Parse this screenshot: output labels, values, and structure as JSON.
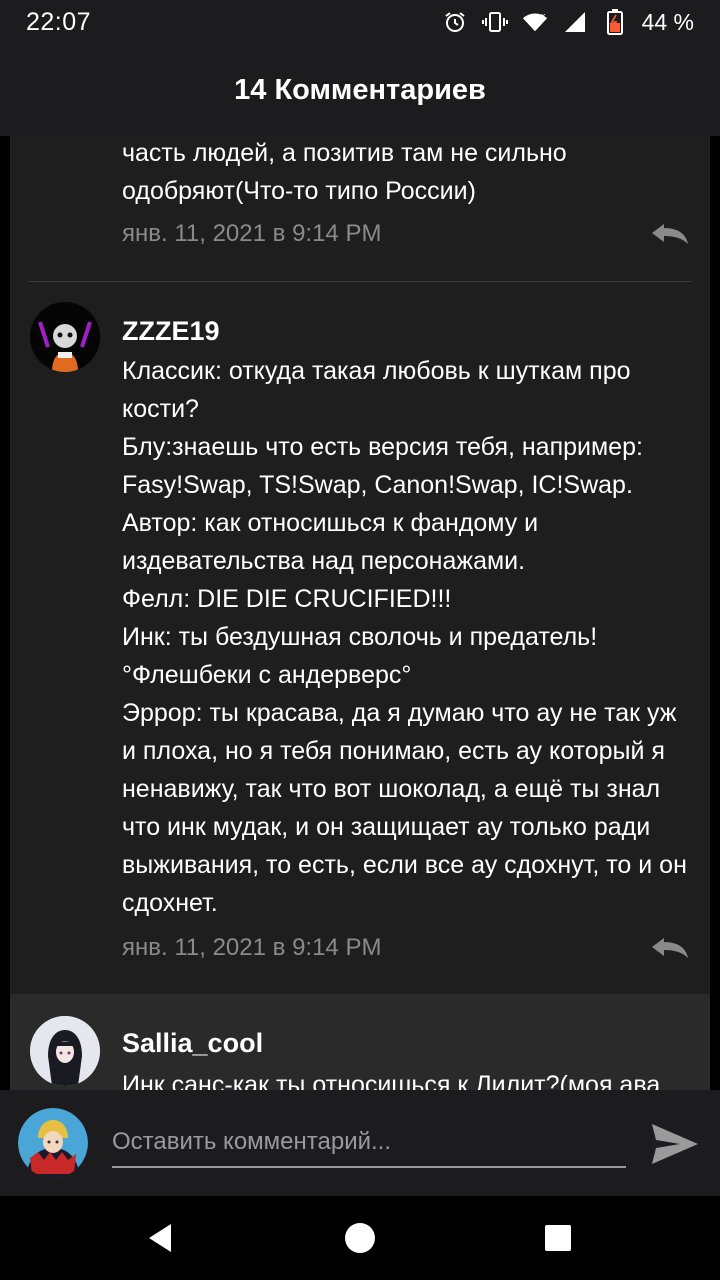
{
  "status_bar": {
    "time": "22:07",
    "battery_percent": "44 %",
    "icons": [
      "alarm-icon",
      "vibrate-icon",
      "wifi-icon",
      "signal-icon",
      "battery-icon"
    ]
  },
  "header": {
    "title": "14 Комментариев"
  },
  "comments": [
    {
      "username": "",
      "text": "часть людей, а позитив там не сильно\nодобряют(Что-то типо России)",
      "date": "янв. 11, 2021 в 9:14 PM"
    },
    {
      "username": "ZZZE19",
      "text": "Классик: откуда такая любовь к шуткам про\nкости?\nБлу:знаешь что есть версия тебя, например:\nFasy!Swap, TS!Swap, Canon!Swap, IC!Swap.\nАвтор: как относишься к фандому и\nиздевательства над персонажами.\nФелл: DIE DIE CRUCIFIED!!!\nИнк: ты бездушная сволочь и предатель!\n°Флешбеки с андерверс°\nЭррор: ты красава, да я думаю что ау не так уж\nи плоха, но я тебя понимаю, есть ау который я\nненавижу, так что вот шоколад, а ещё ты знал\nчто инк мудак, и он защищает ау только ради\nвыживания, то есть, если все ау сдохнут, то и он\nсдохнет.",
      "date": "янв. 11, 2021 в 9:14 PM"
    },
    {
      "username": "Sallia_cool",
      "text": "Инк санс-как ты относишься к Лилит?(моя ава",
      "date": ""
    }
  ],
  "input": {
    "placeholder": "Оставить комментарий..."
  },
  "colors": {
    "background": "#000000",
    "panel": "#1c1c1e",
    "comment_bg": "#1e1e1e",
    "muted_text": "#8a8a8a"
  }
}
